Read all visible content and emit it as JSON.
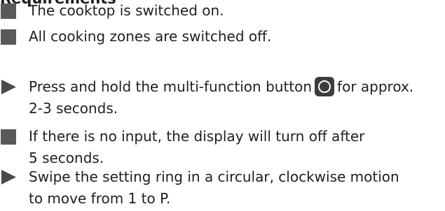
{
  "heading_fragment": "Requirements",
  "requirements": [
    {
      "text": "The cooktop is switched on."
    },
    {
      "text": "All cooking zones are switched off."
    }
  ],
  "steps": [
    {
      "line1_before": "Press and hold the multi-function button",
      "line1_after": "for approx.",
      "line2": "2-3 seconds.",
      "button_icon": "multi-function-button-icon"
    },
    {
      "line1": "If there is no input, the display will turn off after",
      "line2": "5 seconds."
    },
    {
      "line1": "Swipe the setting ring in a circular, clockwise motion",
      "line2": "to move from 1 to P."
    }
  ],
  "colors": {
    "text": "#1f1f1f",
    "bullet_square": "#595959",
    "bullet_triangle": "#4a4a4a",
    "button_fill": "#3d3d3d"
  }
}
